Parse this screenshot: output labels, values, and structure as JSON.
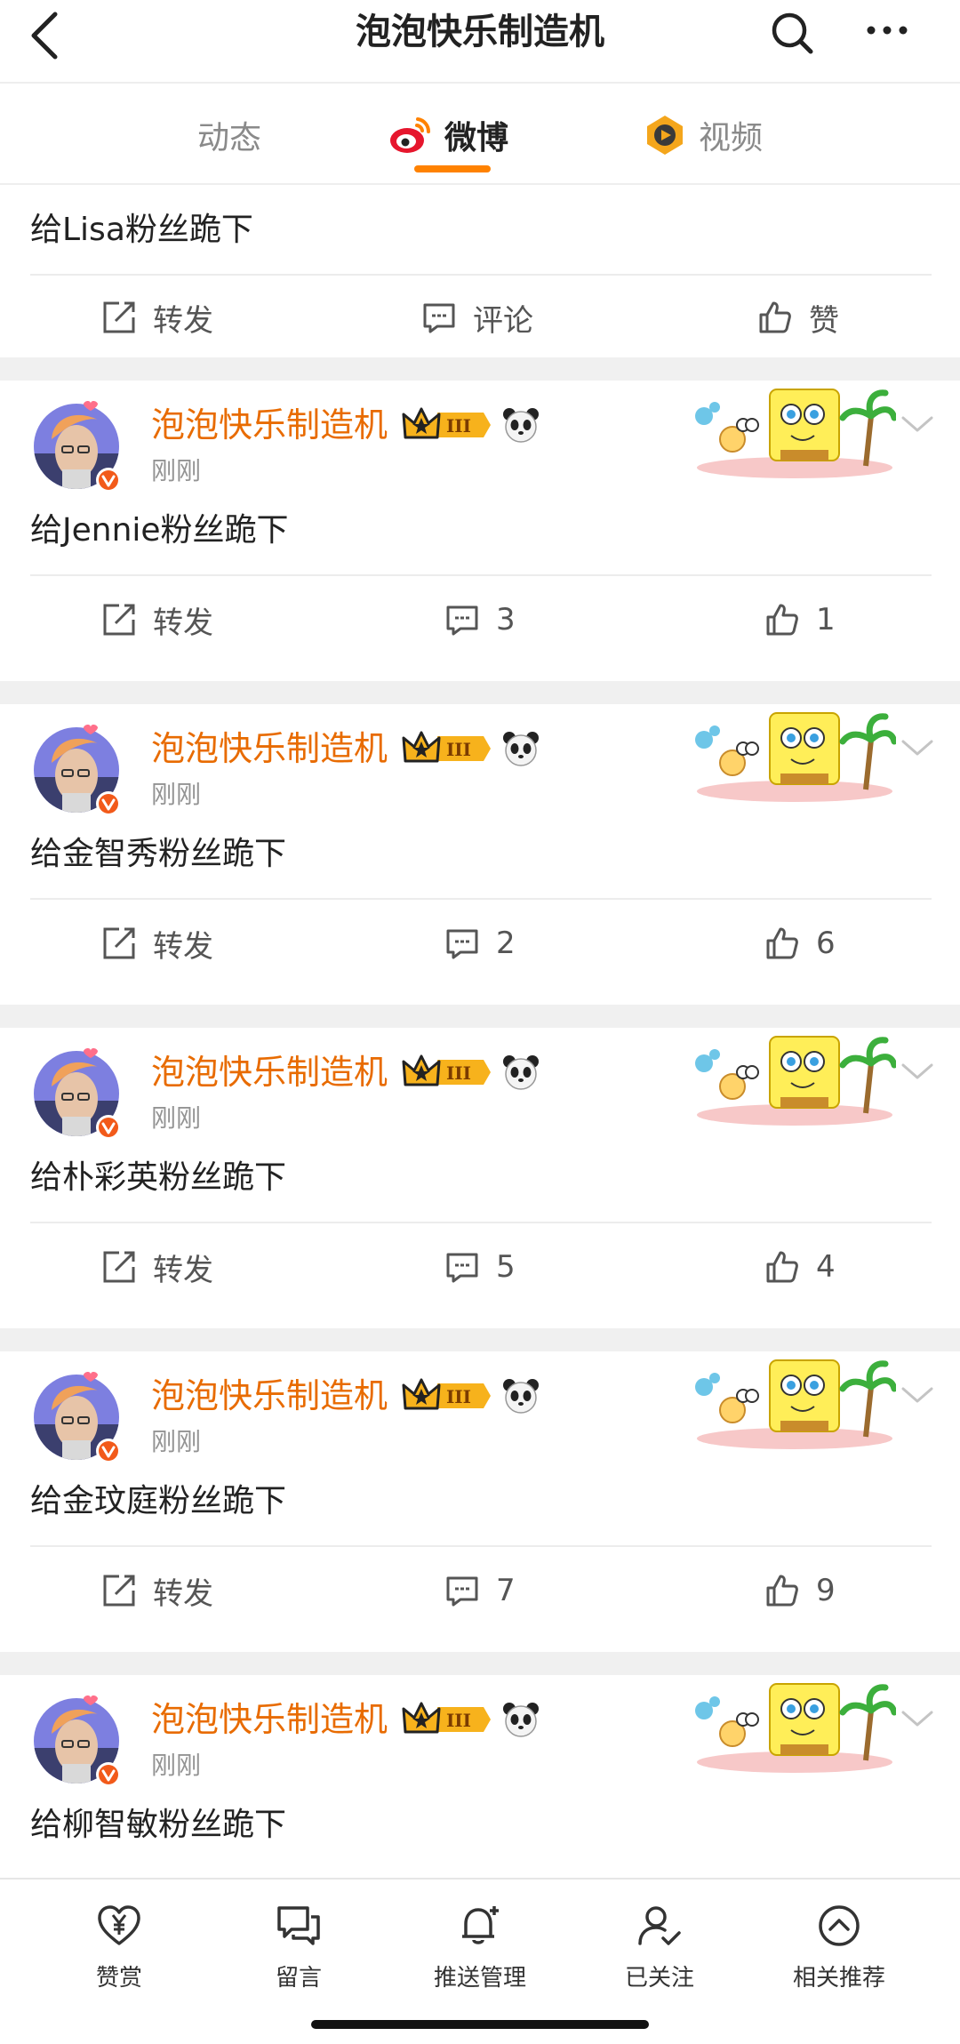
{
  "header": {
    "title": "泡泡快乐制造机",
    "back_icon": "chevron-left-icon",
    "search_icon": "search-icon",
    "more_icon": "more-icon"
  },
  "tabs": [
    {
      "label": "动态",
      "active": false
    },
    {
      "label": "微博",
      "active": true,
      "icon": "weibo-logo-icon"
    },
    {
      "label": "视频",
      "active": false,
      "icon": "video-icon"
    }
  ],
  "accent_color": "#ff8200",
  "username_color": "#e86b00",
  "first_post": {
    "content": "给Lisa粉丝跪下",
    "repost_label": "转发",
    "comment_label": "评论",
    "like_label": "赞"
  },
  "posts": [
    {
      "username": "泡泡快乐制造机",
      "time": "刚刚",
      "content": "给Jennie粉丝跪下",
      "repost_label": "转发",
      "comments": "3",
      "likes": "1"
    },
    {
      "username": "泡泡快乐制造机",
      "time": "刚刚",
      "content": "给金智秀粉丝跪下",
      "repost_label": "转发",
      "comments": "2",
      "likes": "6"
    },
    {
      "username": "泡泡快乐制造机",
      "time": "刚刚",
      "content": "给朴彩英粉丝跪下",
      "repost_label": "转发",
      "comments": "5",
      "likes": "4"
    },
    {
      "username": "泡泡快乐制造机",
      "time": "刚刚",
      "content": "给金玟庭粉丝跪下",
      "repost_label": "转发",
      "comments": "7",
      "likes": "9"
    },
    {
      "username": "泡泡快乐制造机",
      "time": "刚刚",
      "content": "给柳智敏粉丝跪下"
    }
  ],
  "bottom_bar": [
    {
      "label": "赞赏",
      "icon": "heart-yuan-icon"
    },
    {
      "label": "留言",
      "icon": "message-icon"
    },
    {
      "label": "推送管理",
      "icon": "bell-plus-icon"
    },
    {
      "label": "已关注",
      "icon": "user-check-icon"
    },
    {
      "label": "相关推荐",
      "icon": "arrow-up-circle-icon"
    }
  ]
}
